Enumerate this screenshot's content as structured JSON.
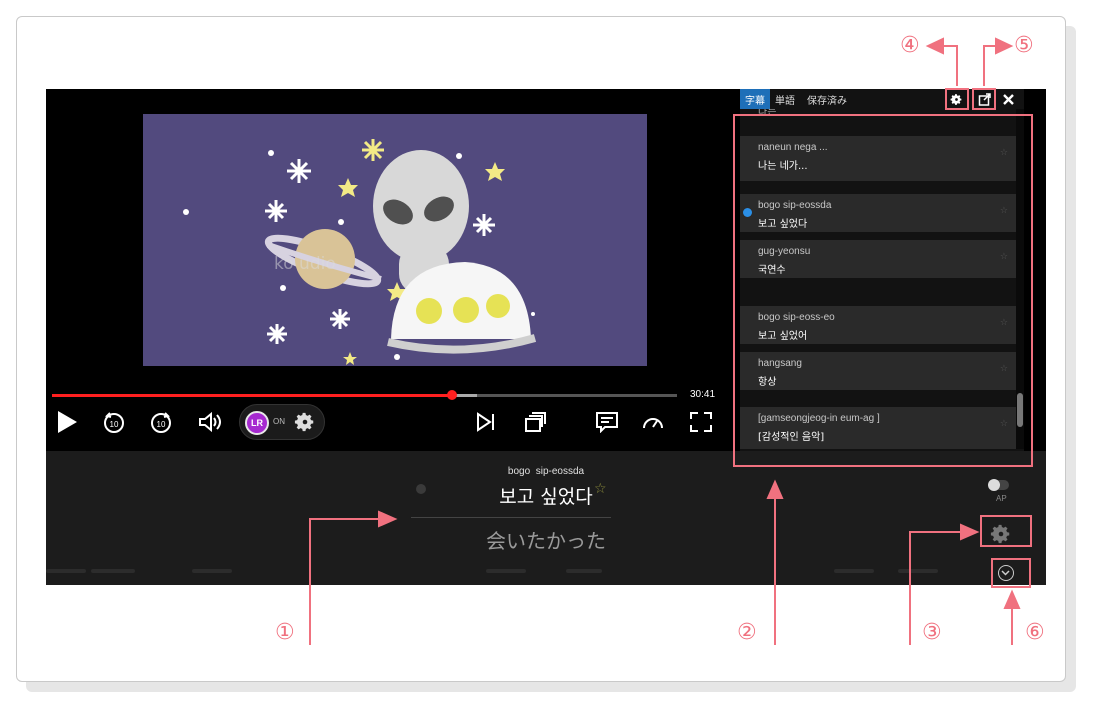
{
  "player": {
    "duration": "30:41",
    "progress_fraction": 0.64,
    "buffered_fraction": 0.68,
    "watermark": "ko            udio",
    "lr_on": "ON"
  },
  "subtitle": {
    "romanization_1": "bogo",
    "romanization_2": "sip-eossda",
    "korean": "보고 싶었다",
    "japanese": "会いたかった",
    "star": "☆",
    "ap_label": "AP"
  },
  "panel": {
    "tabs": [
      {
        "label": "字幕",
        "active": true
      },
      {
        "label": "単語",
        "active": false
      },
      {
        "label": "保存済み",
        "active": false
      }
    ],
    "partial_top": "나는",
    "items": [
      {
        "romanization": "naneun nega ...",
        "korean": "나는 네가...",
        "playing": false
      },
      {
        "romanization": "bogo sip-eossda",
        "korean": "보고 싶었다",
        "playing": true
      },
      {
        "romanization": "gug-yeonsu",
        "korean": "국연수",
        "playing": false
      },
      {
        "romanization": "bogo sip-eoss-eo",
        "korean": "보고 싶었어",
        "playing": false
      },
      {
        "romanization": "hangsang",
        "korean": "항상",
        "playing": false
      },
      {
        "romanization": "[gamseongjeog-in eum-ag ]",
        "korean": "[감성적인 음악]",
        "playing": false
      }
    ],
    "item_star": "☆"
  },
  "annotations": [
    "①",
    "②",
    "③",
    "④",
    "⑤",
    "⑥"
  ],
  "colors": {
    "accent_red": "#ff1f1f",
    "tab_blue": "#1e6fb8",
    "annotation_pink": "#f0717f",
    "lr_purple": "#a62ad0"
  },
  "icons": [
    "play-icon",
    "rewind-10-icon",
    "forward-10-icon",
    "volume-icon",
    "lr-logo-icon",
    "settings-gear-icon",
    "skip-next-icon",
    "miniplayer-icon",
    "subtitles-icon",
    "speed-icon",
    "fullscreen-icon",
    "export-icon",
    "close-icon",
    "collapse-chevron-icon"
  ]
}
